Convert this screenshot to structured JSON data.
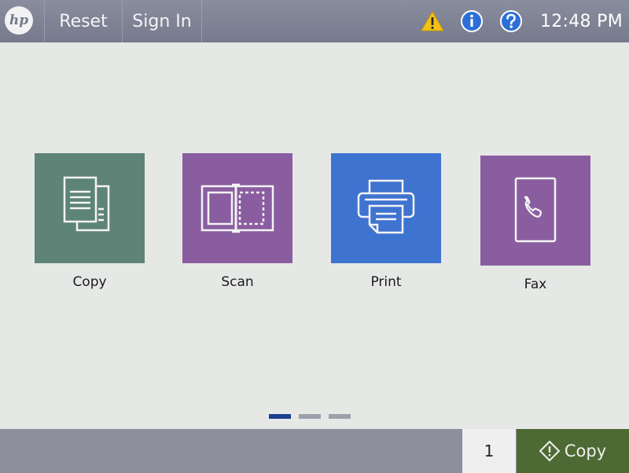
{
  "header": {
    "logo_text": "hp",
    "reset_label": "Reset",
    "signin_label": "Sign In",
    "status_icons": [
      "warning-icon",
      "info-icon",
      "help-icon"
    ],
    "time": "12:48 PM"
  },
  "apps": [
    {
      "label": "Copy",
      "icon": "copy-icon",
      "color": "#5e8377"
    },
    {
      "label": "Scan",
      "icon": "scan-icon",
      "color": "#8a5da0"
    },
    {
      "label": "Print",
      "icon": "print-icon",
      "color": "#3f73d0"
    },
    {
      "label": "Fax",
      "icon": "fax-icon",
      "color": "#8a5da0"
    }
  ],
  "pager": {
    "pages": 3,
    "current": 1
  },
  "footer": {
    "copies": "1",
    "start_label": "Copy"
  },
  "colors": {
    "topbar": "#7f8294",
    "warning": "#f2c21a",
    "info": "#2d6fd6",
    "start_button": "#4e6a34"
  }
}
